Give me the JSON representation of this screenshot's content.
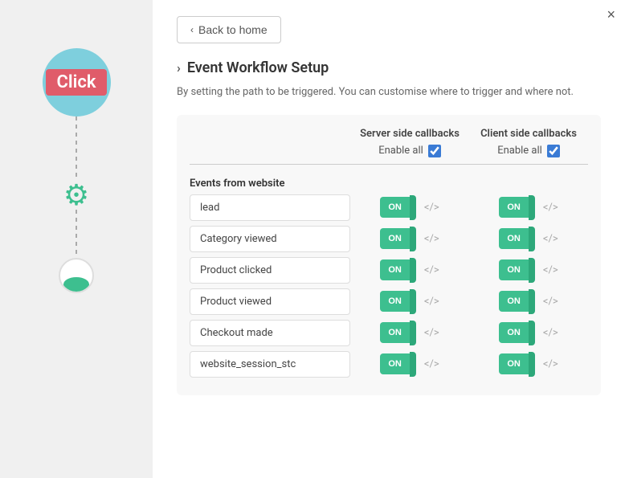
{
  "close_icon": "×",
  "back_button": {
    "label": "Back to home",
    "chevron": "‹"
  },
  "section": {
    "chevron": "›",
    "title": "Event Workflow Setup",
    "description": "By setting the path to be triggered. You can customise where to trigger and where not."
  },
  "table": {
    "columns": {
      "server": "Server side callbacks",
      "client": "Client side callbacks"
    },
    "enable_all_label": "Enable all",
    "events_section_label": "Events from website",
    "events": [
      {
        "name": "lead"
      },
      {
        "name": "Category viewed"
      },
      {
        "name": "Product clicked"
      },
      {
        "name": "Product viewed"
      },
      {
        "name": "Checkout made"
      },
      {
        "name": "website_session_stc"
      }
    ],
    "toggle_label": "ON",
    "code_icon": "</>",
    "server_code_icon": "</>",
    "client_code_icon": "</>"
  },
  "sidebar": {
    "click_label": "Click"
  }
}
